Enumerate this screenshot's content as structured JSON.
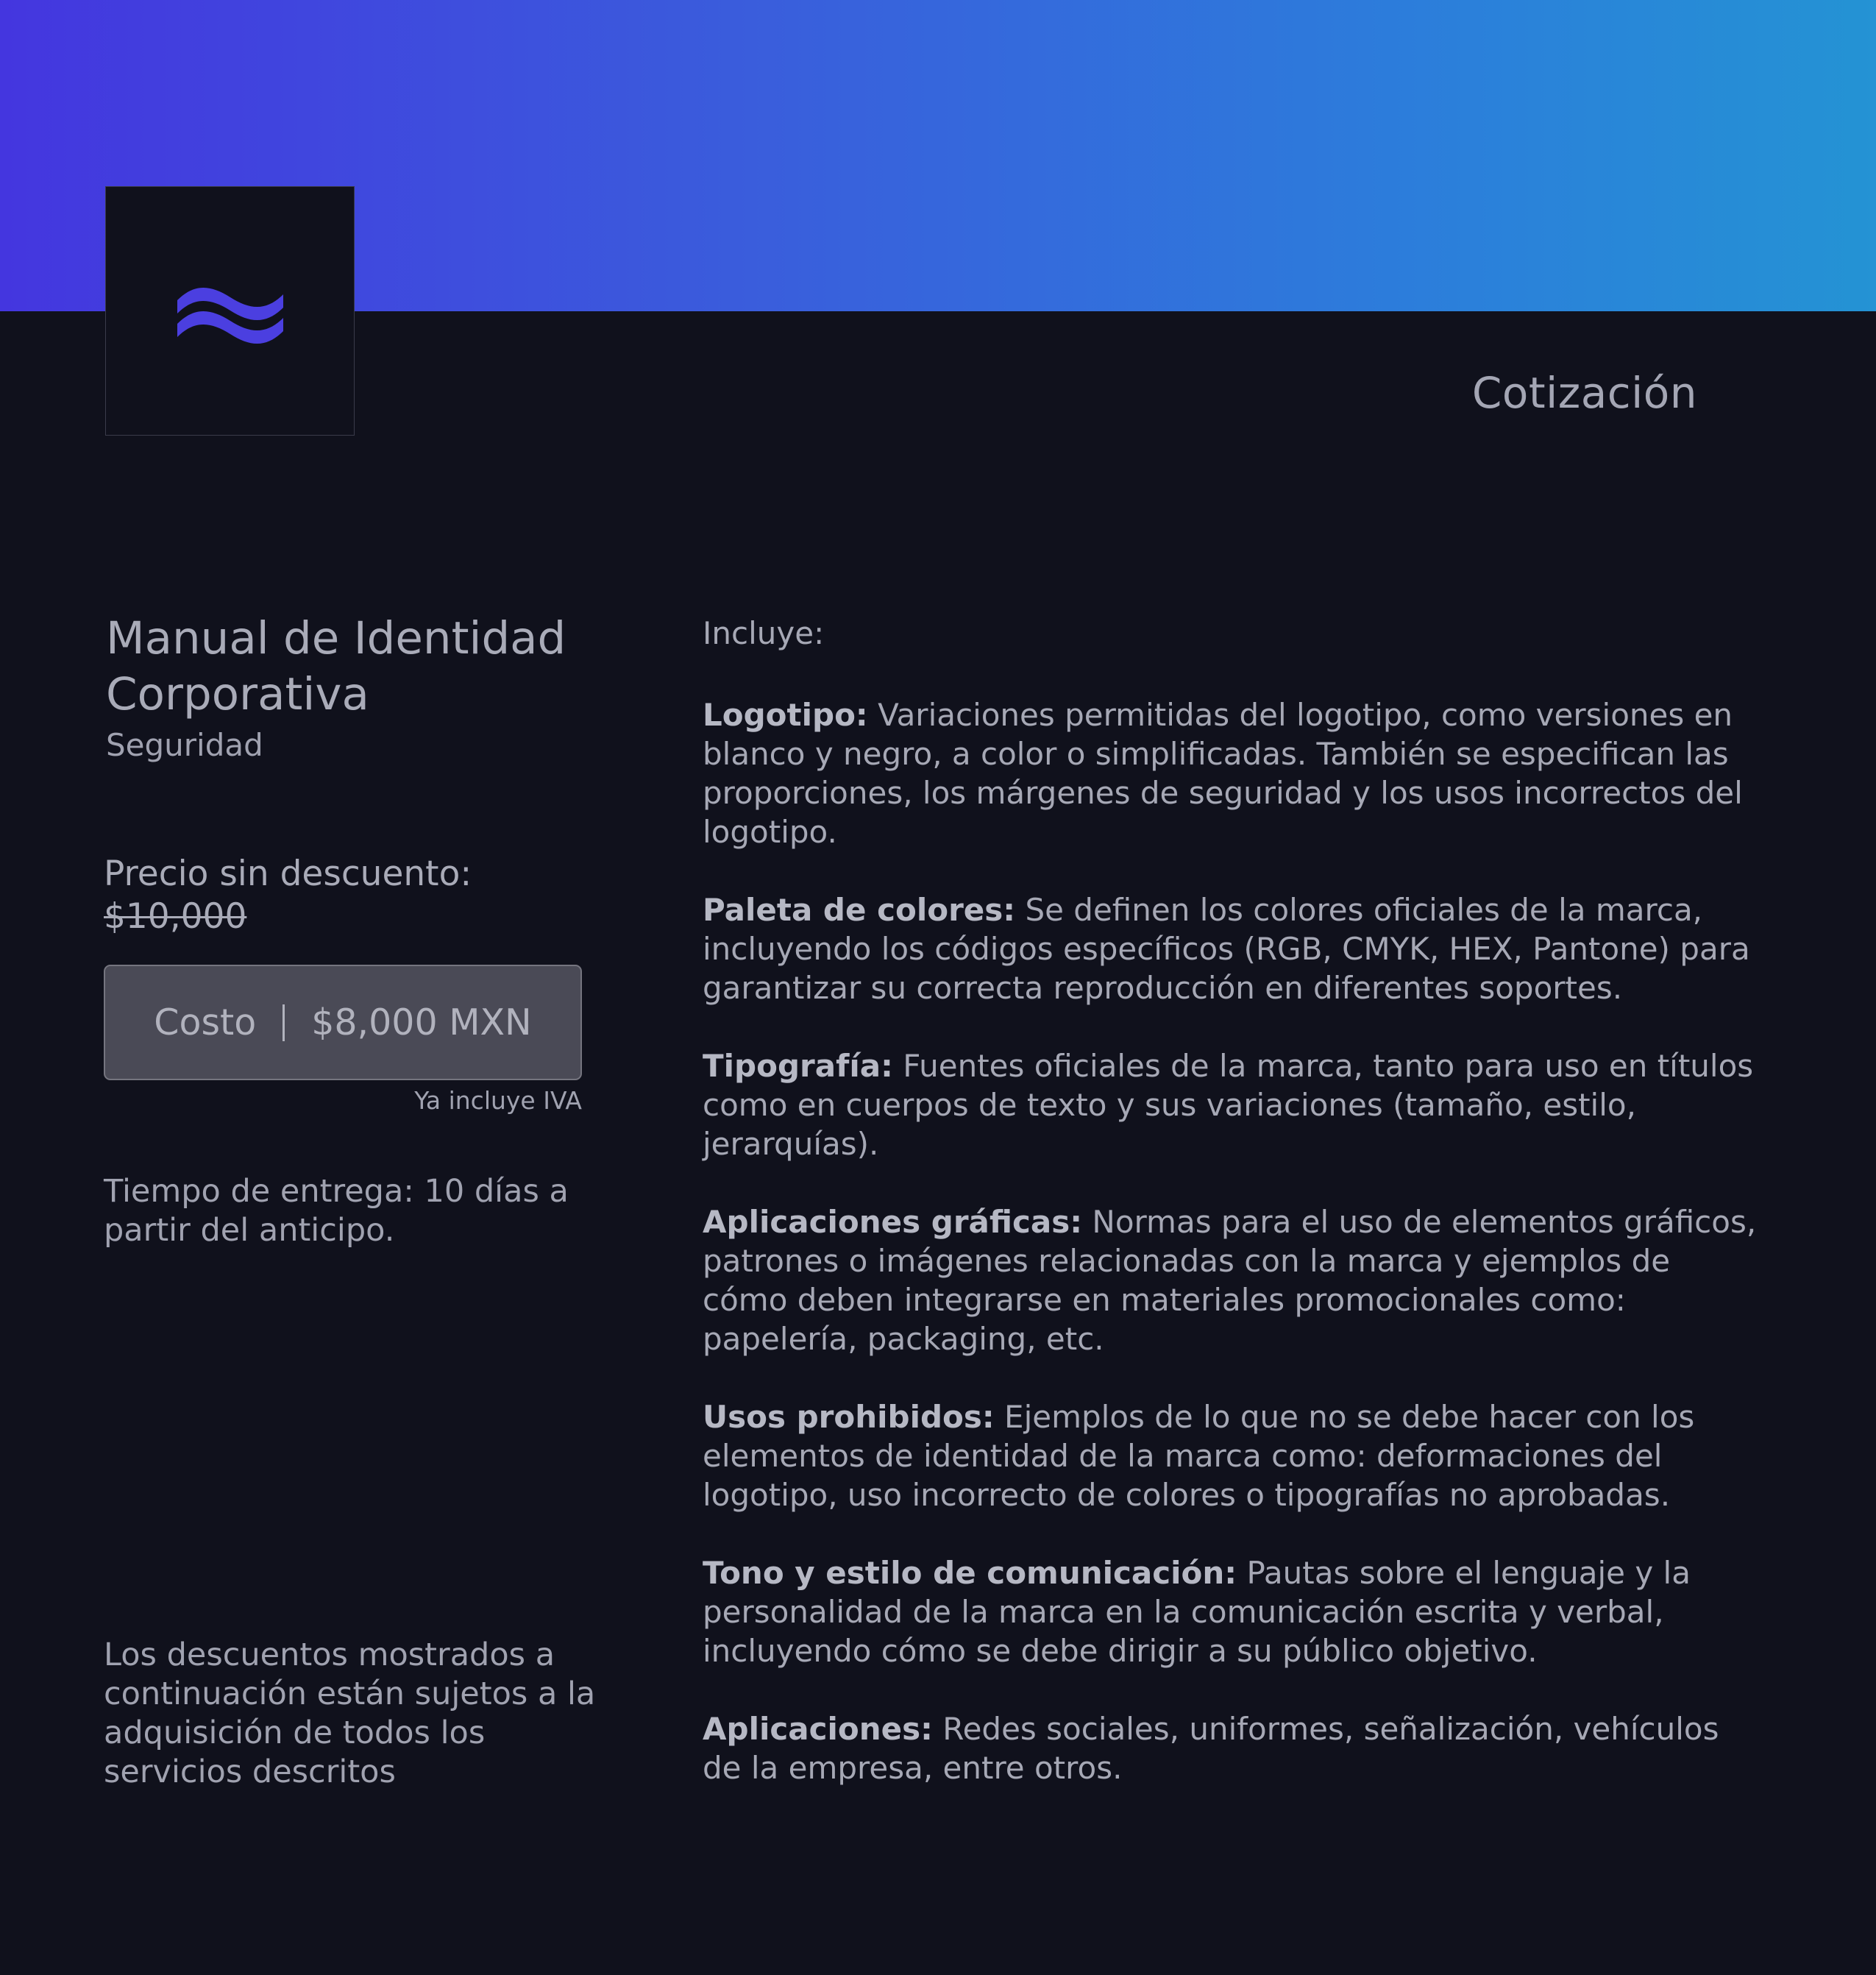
{
  "header": {
    "document_title": "Cotización",
    "logo_icon": "wave-logo-icon",
    "gradient_colors": [
      "#4436df",
      "#2493d4"
    ],
    "logo_color": "#4b3fe0"
  },
  "service": {
    "name": "Manual de Identidad Corporativa",
    "category": "Seguridad"
  },
  "pricing": {
    "price_label": "Precio sin descuento:",
    "original_price": "$10,000",
    "cost_label": "Costo",
    "cost_value": "$8,000 MXN",
    "tax_note": "Ya incluye IVA",
    "delivery_text": "Tiempo de entrega: 10 días a partir del anticipo."
  },
  "disclaimer": "Los descuentos mostrados a continuación están sujetos a la adquisición de todos los servicios descritos",
  "includes": {
    "label": "Incluye:",
    "items": [
      {
        "title": "Logotipo:",
        "text": "Variaciones permitidas del logotipo, como versiones en blanco y negro, a color o simplificadas. También se especifican las proporciones, los márgenes de seguridad y los usos incorrectos del logotipo."
      },
      {
        "title": "Paleta de colores:",
        "text": "Se definen los colores oficiales de la marca, incluyendo los códigos específicos (RGB, CMYK, HEX, Pantone) para garantizar su correcta reproducción en diferentes soportes."
      },
      {
        "title": "Tipografía:",
        "text": "Fuentes oficiales de la marca, tanto para uso en títulos como en cuerpos de texto y sus variaciones (tamaño, estilo, jerarquías)."
      },
      {
        "title": "Aplicaciones gráficas:",
        "text": "Normas para el uso de elementos gráficos, patrones o imágenes relacionadas con la marca y ejemplos de cómo deben integrarse en materiales promocionales como: papelería, packaging, etc."
      },
      {
        "title": "Usos prohibidos:",
        "text": "Ejemplos de lo que no se debe hacer con los elementos de identidad de la marca como: deformaciones del logotipo, uso incorrecto de colores o tipografías no aprobadas."
      },
      {
        "title": "Tono y estilo de comunicación:",
        "text": "Pautas sobre el lenguaje y la personalidad de la marca en la comunicación escrita y verbal, incluyendo cómo se debe dirigir a su público objetivo."
      },
      {
        "title": "Aplicaciones:",
        "text": " Redes sociales, uniformes, señalización, vehículos de la empresa, entre otros."
      }
    ]
  }
}
